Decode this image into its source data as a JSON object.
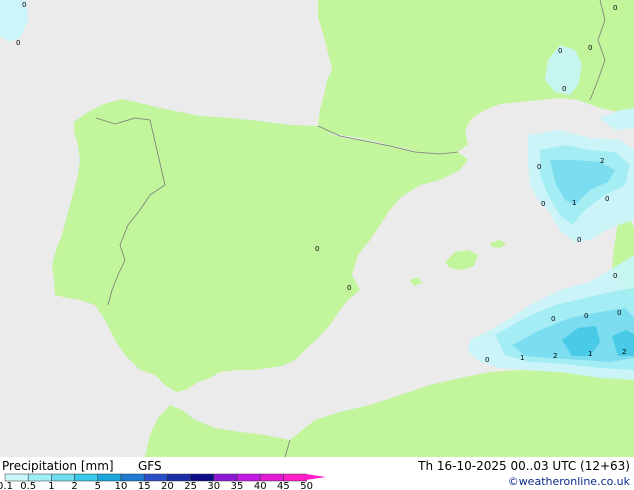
{
  "header": {
    "title": "Precipitation [mm]",
    "model": "GFS",
    "valid_time": "Th 16-10-2025 00..03 UTC (12+63)",
    "credit": "©weatheronline.co.uk"
  },
  "legend": {
    "ticks": [
      "0.1",
      "0.5",
      "1",
      "2",
      "5",
      "10",
      "15",
      "20",
      "25",
      "30",
      "35",
      "40",
      "45",
      "50"
    ],
    "colors": [
      "#c8f6fa",
      "#9eeef6",
      "#6fdcf0",
      "#38c8e8",
      "#1aa6dc",
      "#1f7ad2",
      "#2a4fc8",
      "#1a2ea8",
      "#0b0e86",
      "#8c1ad6",
      "#c21ae0",
      "#e21ad6",
      "#ff1ec8"
    ]
  },
  "map": {
    "colors": {
      "sea": "#ebebeb",
      "land": "#c3f59c",
      "border": "#7a7a7a",
      "coast": "#8a8a8a"
    },
    "contour_labels": [
      "0",
      "0",
      "0",
      "0",
      "0",
      "0",
      "0",
      "2",
      "0",
      "1",
      "0",
      "0",
      "0",
      "0",
      "0",
      "0",
      "0",
      "1",
      "2",
      "1",
      "2",
      "0",
      "0"
    ]
  }
}
